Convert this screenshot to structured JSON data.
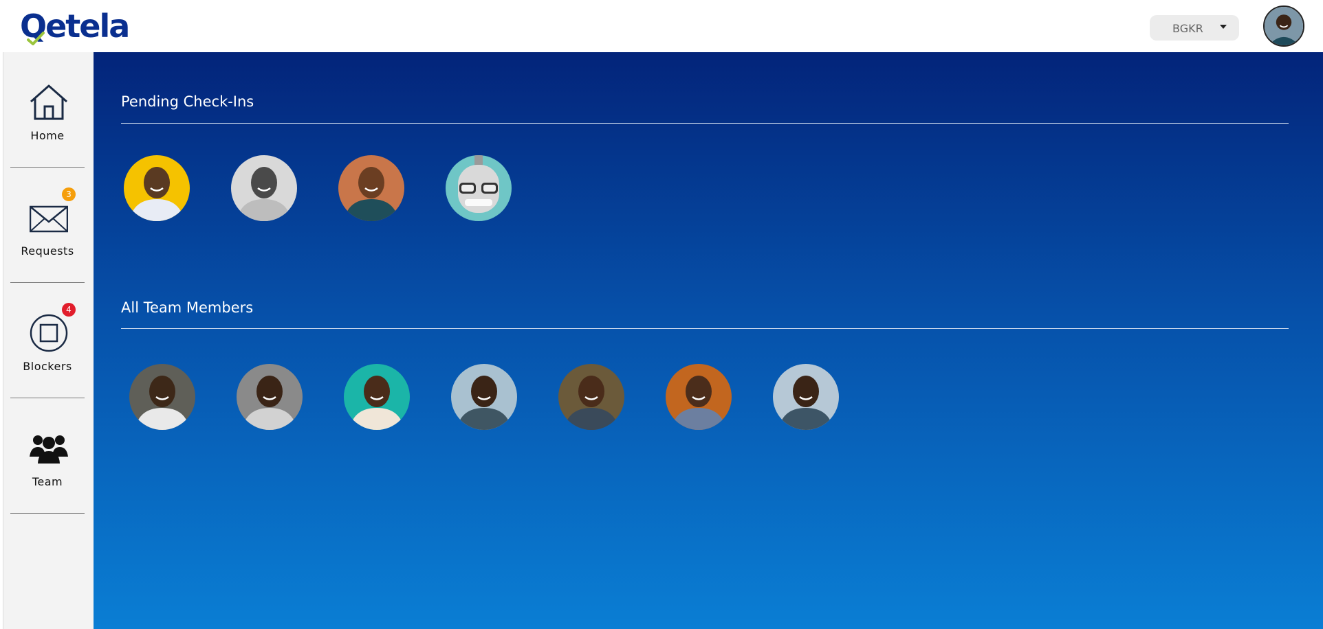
{
  "app": {
    "logo_text": "Qetela"
  },
  "header": {
    "org_selector": {
      "value": "BGKR"
    }
  },
  "sidebar": {
    "items": [
      {
        "label": "Home",
        "icon": "home-icon"
      },
      {
        "label": "Requests",
        "icon": "envelope-icon",
        "badge": "3",
        "badge_color": "#f59e0b"
      },
      {
        "label": "Blockers",
        "icon": "square-icon",
        "badge": "4",
        "badge_color": "#e11d2b"
      },
      {
        "label": "Team",
        "icon": "team-icon"
      }
    ]
  },
  "main": {
    "pending": {
      "title": "Pending Check-Ins",
      "avatars": [
        {
          "bg": "#f5c200",
          "skin": "#5a3a22",
          "shirt": "#e8ecf5"
        },
        {
          "bg": "#d9d9d9",
          "skin": "#4a4a4a",
          "shirt": "#bdbdbd"
        },
        {
          "bg": "#c9764a",
          "skin": "#6b3e22",
          "shirt": "#1f4e5a"
        },
        {
          "bg": "#6fc6c6",
          "skin": "#d9d9d9",
          "shirt": "#b9b9b9"
        }
      ]
    },
    "team": {
      "title": "All Team Members",
      "avatars": [
        {
          "bg": "#5f5f58",
          "skin": "#3d2818",
          "shirt": "#e9e9e9"
        },
        {
          "bg": "#8a8a8a",
          "skin": "#3a2416",
          "shirt": "#d2d2d2"
        },
        {
          "bg": "#1bb5a8",
          "skin": "#4a2c1a",
          "shirt": "#f0e6d8"
        },
        {
          "bg": "#a9c1d0",
          "skin": "#3a2416",
          "shirt": "#3f5663"
        },
        {
          "bg": "#6b5a3a",
          "skin": "#4a2c1a",
          "shirt": "#3a4a5a"
        },
        {
          "bg": "#c2661f",
          "skin": "#4b2d1b",
          "shirt": "#6c7fa0"
        },
        {
          "bg": "#b6c8d6",
          "skin": "#3a2416",
          "shirt": "#3d5566"
        }
      ]
    }
  }
}
